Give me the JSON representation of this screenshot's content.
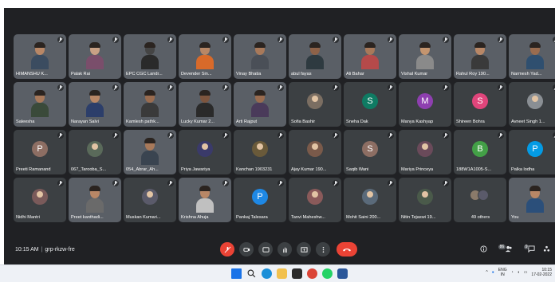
{
  "meeting": {
    "time": "10:15 AM",
    "code": "grp-rkzw-fre",
    "participant_count": "86",
    "chat_count": "9"
  },
  "participants": [
    {
      "name": "HIMANSHU K...",
      "type": "video",
      "skin": "#b88766",
      "shirt": "#3b4c60"
    },
    {
      "name": "Palak Rai",
      "type": "video",
      "skin": "#c9a185",
      "shirt": "#7a4e6b"
    },
    {
      "name": "EPC CGC Landr...",
      "type": "video",
      "skin": "#444444",
      "shirt": "#2a2a2a"
    },
    {
      "name": "Devender Sin...",
      "type": "video",
      "skin": "#b88766",
      "shirt": "#d86a2a"
    },
    {
      "name": "Vinay Bhatia",
      "type": "video",
      "skin": "#a8795a",
      "shirt": "#4a4f57"
    },
    {
      "name": "abul fayas",
      "type": "video",
      "skin": "#8e6248",
      "shirt": "#2e3a40"
    },
    {
      "name": "Ali Bahar",
      "type": "video",
      "skin": "#a8795a",
      "shirt": "#b54a4a"
    },
    {
      "name": "Vishal Kumar",
      "type": "video",
      "skin": "#c4956f",
      "shirt": "#8a8a8a"
    },
    {
      "name": "Rahul Roy 190...",
      "type": "video",
      "skin": "#b88766",
      "shirt": "#3a3a3a"
    },
    {
      "name": "Narmesh Yad...",
      "type": "video",
      "skin": "#9a6c4f",
      "shirt": "#2f4f6f"
    },
    {
      "name": "Saleesha",
      "type": "video",
      "skin": "#a8795a",
      "shirt": "#3a4a3a"
    },
    {
      "name": "Narayan Salvi",
      "type": "video",
      "skin": "#b88766",
      "shirt": "#2c3e6a"
    },
    {
      "name": "Kamlesh pathk...",
      "type": "video",
      "skin": "#9a6c4f",
      "shirt": "#3a3a3a"
    },
    {
      "name": "Lucky Kumar 2...",
      "type": "video",
      "skin": "#7d553e",
      "shirt": "#2a2a2a"
    },
    {
      "name": "Arti Rajput",
      "type": "video",
      "skin": "#9a6c4f",
      "shirt": "#4a3a5a"
    },
    {
      "name": "Sofia Bashir",
      "type": "avatar",
      "color": "#7b6e62"
    },
    {
      "name": "Sneha Dak",
      "type": "letter",
      "letter": "S",
      "color": "#0f7b63"
    },
    {
      "name": "Manya Kashyap",
      "type": "letter",
      "letter": "M",
      "color": "#8e3fb0"
    },
    {
      "name": "Shireen Bohra",
      "type": "letter",
      "letter": "S",
      "color": "#e0457b"
    },
    {
      "name": "Avneet Singh 1...",
      "type": "avatar",
      "color": "#8a8f94"
    },
    {
      "name": "Preeti Ramanand",
      "type": "letter",
      "letter": "P",
      "color": "#8d6e63"
    },
    {
      "name": "067_Tarooba_S...",
      "type": "avatar",
      "color": "#5a6a5a"
    },
    {
      "name": "054_Abrar_Ah...",
      "type": "video",
      "skin": "#a8795a",
      "shirt": "#3a4450"
    },
    {
      "name": "Priya Jawariya",
      "type": "avatar",
      "color": "#3a3a6a"
    },
    {
      "name": "Kanchan 1903231",
      "type": "avatar",
      "color": "#6a5a3a"
    },
    {
      "name": "Ajay Kumar 190...",
      "type": "avatar",
      "color": "#7a5a4a"
    },
    {
      "name": "Saqib Wani",
      "type": "letter",
      "letter": "S",
      "color": "#8d6e63"
    },
    {
      "name": "Mariya Princeya",
      "type": "avatar",
      "color": "#6a4a5a"
    },
    {
      "name": "188W1A1005-S...",
      "type": "letter",
      "letter": "B",
      "color": "#43a047"
    },
    {
      "name": "Palka lodha",
      "type": "letter",
      "letter": "P",
      "color": "#039be5"
    },
    {
      "name": "Nidhi Mantri",
      "type": "avatar",
      "color": "#7a5a5a"
    },
    {
      "name": "Preet kanthadi...",
      "type": "video",
      "skin": "#b88766",
      "shirt": "#6a6a6a"
    },
    {
      "name": "Muskan Kumari...",
      "type": "avatar",
      "color": "#5a5a6a"
    },
    {
      "name": "Krishna Ahuja",
      "type": "video",
      "skin": "#b88766",
      "shirt": "#c0c0c0"
    },
    {
      "name": "Pankaj Talesara",
      "type": "letter",
      "letter": "P",
      "color": "#1e88e5"
    },
    {
      "name": "Tanvi Maheshw...",
      "type": "avatar",
      "color": "#8a5a5a"
    },
    {
      "name": "Mohit Saini 200...",
      "type": "avatar",
      "color": "#5a6a7a"
    },
    {
      "name": "Nitin Tejaswi 19...",
      "type": "avatar",
      "color": "#4a5a4a"
    },
    {
      "name": "49 others",
      "type": "others"
    },
    {
      "name": "You",
      "type": "video",
      "skin": "#b88766",
      "shirt": "#2b4f7a"
    }
  ],
  "taskbar": {
    "language": "ENG",
    "region": "IN",
    "time": "10:15",
    "date": "17-02-2022"
  },
  "colors": {
    "meet_bg": "#202124",
    "tile_bg": "#3c4043",
    "end_call": "#ea4335"
  }
}
